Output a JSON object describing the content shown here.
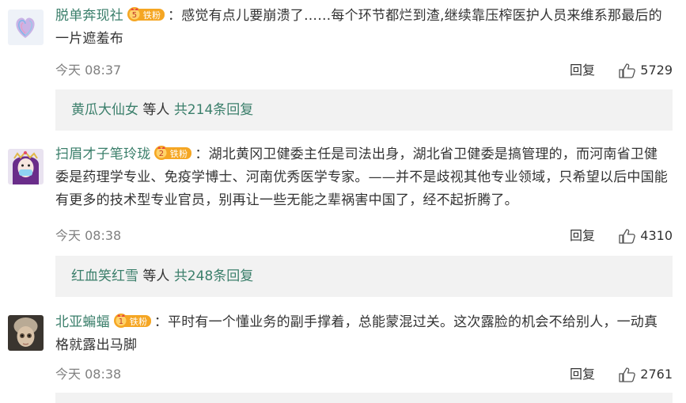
{
  "comments": [
    {
      "username": "脱单奔现社",
      "badge_level": "5",
      "badge_text": "铁粉",
      "text": "：感觉有点儿要崩溃了……每个环节都烂到渣,继续靠压榨医护人员来维系那最后的一片遮羞布",
      "time": "今天 08:37",
      "reply_label": "回复",
      "likes": "5729",
      "thread": {
        "name": "黄瓜大仙女",
        "mid": " 等人 ",
        "count": "共214条回复"
      }
    },
    {
      "username": "扫眉才子笔玲珑",
      "badge_level": "2",
      "badge_text": "铁粉",
      "text": "：湖北黄冈卫健委主任是司法出身，湖北省卫健委是搞管理的，而河南省卫健委是药理学专业、免疫学博士、河南优秀医学专家。——并不是歧视其他专业领域，只希望以后中国能有更多的技术型专业官员，别再让一些无能之辈祸害中国了，经不起折腾了。",
      "time": "今天 08:38",
      "reply_label": "回复",
      "likes": "4310",
      "thread": {
        "name": "红血笑红雪",
        "mid": " 等人 ",
        "count": "共248条回复"
      }
    },
    {
      "username": "北亚蝙蝠",
      "badge_level": "1",
      "badge_text": "铁粉",
      "text": "：平时有一个懂业务的副手撑着，总能蒙混过关。这次露脸的机会不给别人，一动真格就露出马脚",
      "time": "今天 08:38",
      "reply_label": "回复",
      "likes": "2761"
    }
  ],
  "colors": {
    "username": "#3b7f6b",
    "thread_bg": "#f2f2f2",
    "badge_bg": "#f5a623",
    "meta": "#808080"
  },
  "icons": {
    "like": "thumbs-up-icon",
    "badge": "fan-badge-icon"
  }
}
